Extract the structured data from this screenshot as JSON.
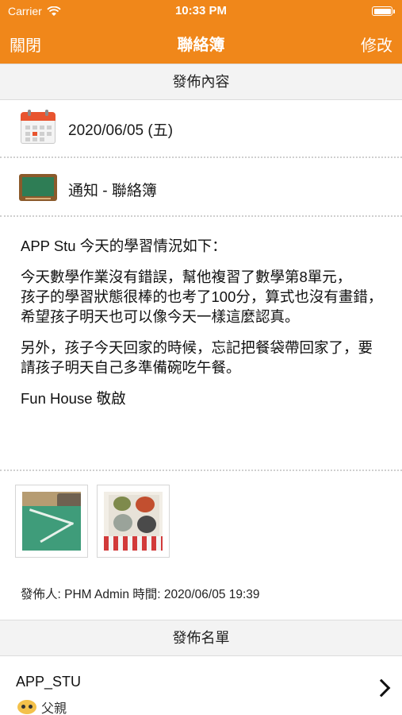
{
  "status_bar": {
    "carrier": "Carrier",
    "time": "10:33 PM"
  },
  "nav": {
    "left": "關閉",
    "title": "聯絡簿",
    "right": "修改"
  },
  "sections": {
    "content_header": "發佈內容",
    "recipients_header": "發佈名單"
  },
  "date_row": {
    "icon": "calendar-icon",
    "text": "2020/06/05 (五)"
  },
  "category_row": {
    "icon": "chalkboard-icon",
    "text": "通知 - 聯絡簿"
  },
  "message": {
    "paragraphs": [
      "APP Stu 今天的學習情況如下：",
      "今天數學作業沒有錯誤，幫他複習了數學第8單元，",
      "孩子的學習狀態很棒的也考了100分，算式也沒有畫錯，",
      "希望孩子明天也可以像今天一樣這麼認真。",
      "另外，孩子今天回家的時候，忘記把餐袋帶回家了，要請孩子明天自己多準備碗吃午餐。",
      "Fun House 敬啟"
    ]
  },
  "meta": "發佈人: PHM Admin 時間: 2020/06/05 19:39",
  "recipients": [
    {
      "name": "APP_STU",
      "role": "父親"
    }
  ],
  "colors": {
    "accent": "#f0871a"
  }
}
